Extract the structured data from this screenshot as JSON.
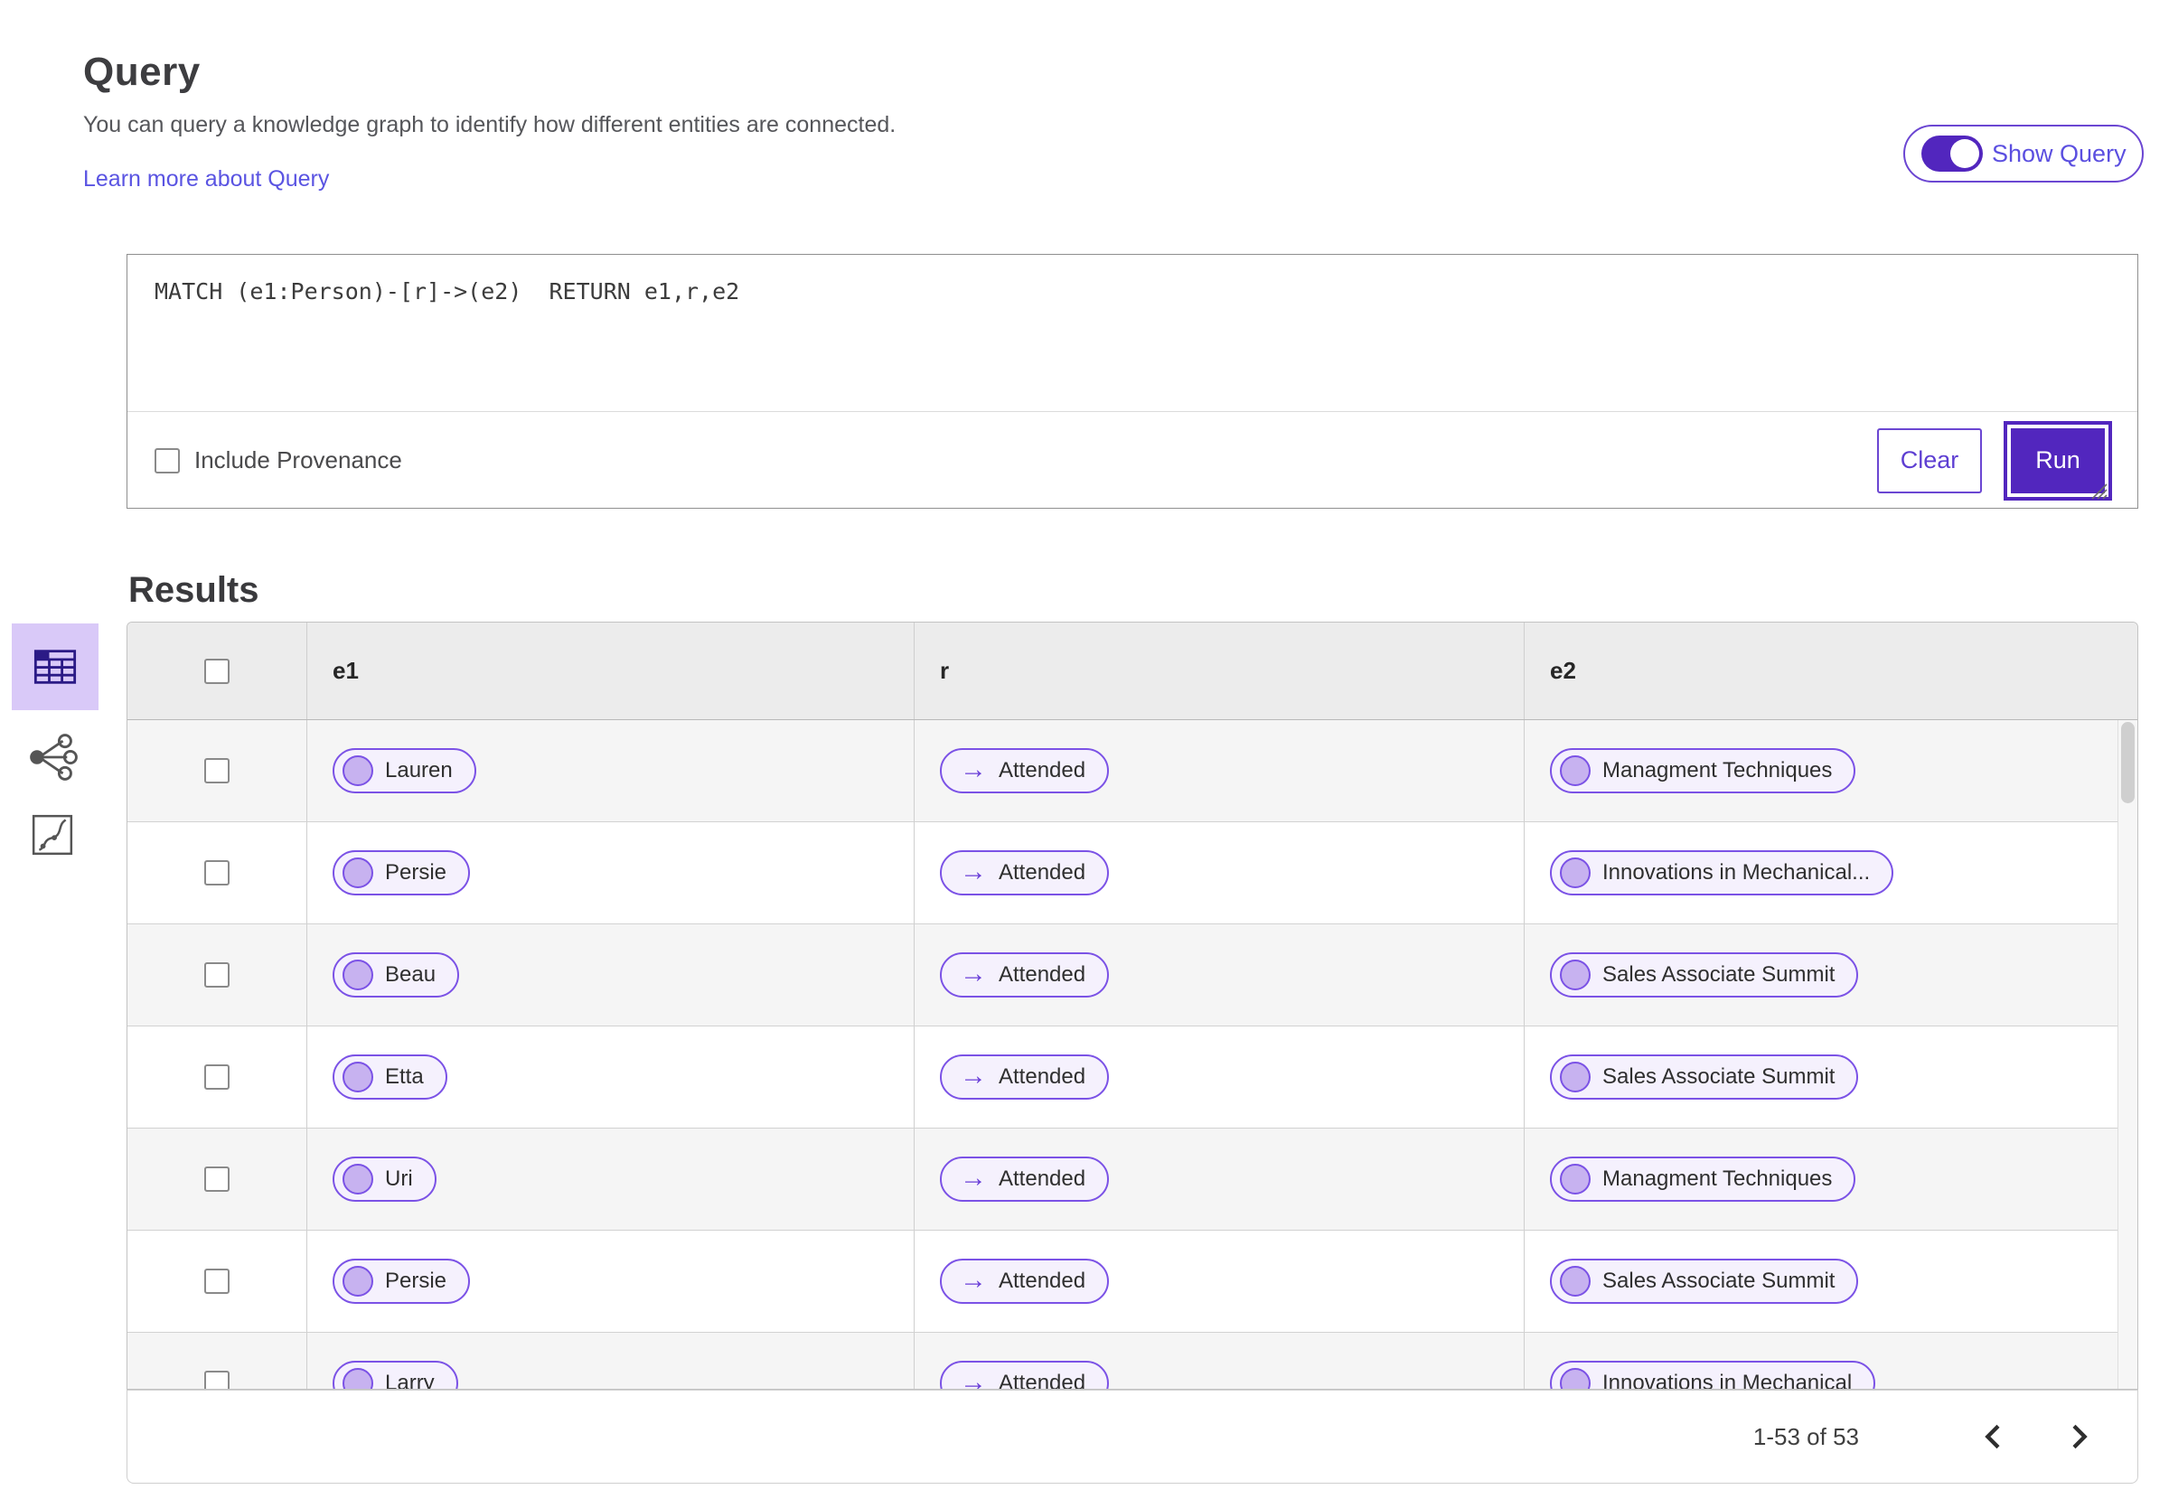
{
  "page": {
    "title": "Query",
    "description": "You can query a knowledge graph to identify how different entities are connected.",
    "learn_more_link": "Learn more about Query",
    "show_query_toggle": {
      "label": "Show Query",
      "state": "on"
    }
  },
  "query_editor": {
    "text": "MATCH (e1:Person)-[r]->(e2)  RETURN e1,r,e2",
    "include_provenance_label": "Include Provenance",
    "include_provenance_checked": false,
    "clear_button": "Clear",
    "run_button": "Run"
  },
  "view_toolbar": {
    "items": [
      {
        "name": "table-view",
        "selected": true
      },
      {
        "name": "graph-view",
        "selected": false
      },
      {
        "name": "chart-view",
        "selected": false
      }
    ]
  },
  "results": {
    "title": "Results",
    "columns": [
      "e1",
      "r",
      "e2"
    ],
    "rows": [
      {
        "e1": "Lauren",
        "r": "Attended",
        "e2": "Managment Techniques"
      },
      {
        "e1": "Persie",
        "r": "Attended",
        "e2": "Innovations in Mechanical..."
      },
      {
        "e1": "Beau",
        "r": "Attended",
        "e2": "Sales Associate Summit"
      },
      {
        "e1": "Etta",
        "r": "Attended",
        "e2": "Sales Associate Summit"
      },
      {
        "e1": "Uri",
        "r": "Attended",
        "e2": "Managment Techniques"
      },
      {
        "e1": "Persie",
        "r": "Attended",
        "e2": "Sales Associate Summit"
      },
      {
        "e1": "Larry",
        "r": "Attended",
        "e2": "Innovations in Mechanical"
      }
    ],
    "pagination": {
      "range": "1-53 of 53"
    }
  },
  "colors": {
    "accent_purple": "#5226be",
    "pill_border": "#7b52e6",
    "pill_bg": "#f5f1fd",
    "pill_circle": "#c7b2f0",
    "selected_tool_bg": "#d9c9f8",
    "link_purple": "#5a54e2",
    "header_gray": "#ececec",
    "row_alt_gray": "#f5f5f5"
  }
}
